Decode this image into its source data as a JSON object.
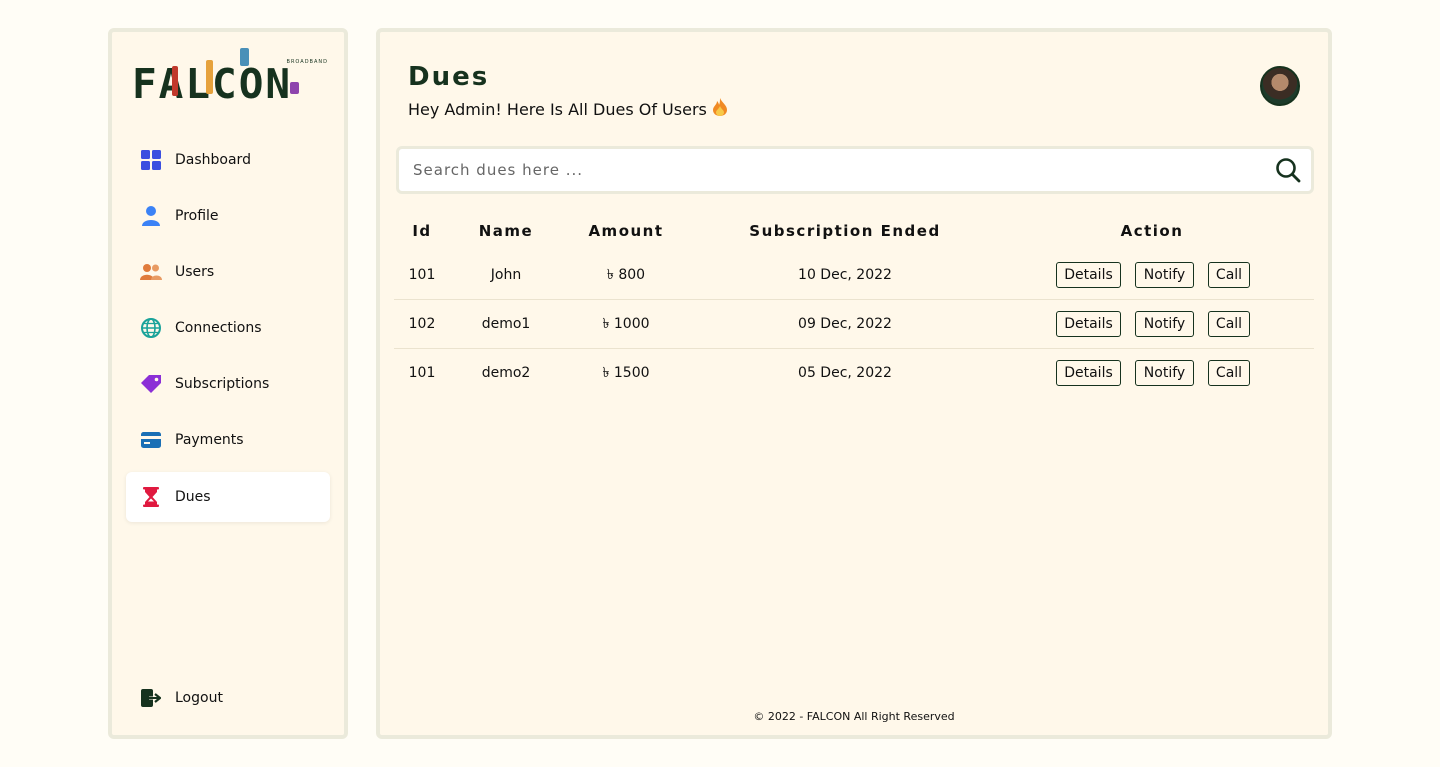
{
  "brand": {
    "name": "FALCON",
    "tagline": "BROADBAND"
  },
  "sidebar": {
    "items": [
      {
        "label": "Dashboard",
        "icon": "dashboard-grid-icon",
        "color": "#3b4fe0"
      },
      {
        "label": "Profile",
        "icon": "user-icon",
        "color": "#3b82f6"
      },
      {
        "label": "Users",
        "icon": "users-icon",
        "color": "#e07b3c"
      },
      {
        "label": "Connections",
        "icon": "globe-icon",
        "color": "#1aa39a"
      },
      {
        "label": "Subscriptions",
        "icon": "tags-icon",
        "color": "#8b2fd6"
      },
      {
        "label": "Payments",
        "icon": "credit-card-icon",
        "color": "#1a6fb5"
      },
      {
        "label": "Dues",
        "icon": "hourglass-icon",
        "color": "#e0193f",
        "active": true
      }
    ],
    "logout": {
      "label": "Logout",
      "icon": "logout-icon",
      "color": "#16321e"
    }
  },
  "header": {
    "title": "Dues",
    "subtitle": "Hey Admin! Here Is All Dues Of Users",
    "subtitle_icon": "flame-icon"
  },
  "search": {
    "placeholder": "Search dues here ...",
    "value": ""
  },
  "table": {
    "columns": [
      "Id",
      "Name",
      "Amount",
      "Subscription Ended",
      "Action"
    ],
    "rows": [
      {
        "id": "101",
        "name": "John",
        "amount": "৳ 800",
        "ended": "10 Dec, 2022"
      },
      {
        "id": "102",
        "name": "demo1",
        "amount": "৳ 1000",
        "ended": "09 Dec, 2022"
      },
      {
        "id": "101",
        "name": "demo2",
        "amount": "৳ 1500",
        "ended": "05 Dec, 2022"
      }
    ],
    "actions": {
      "details": "Details",
      "notify": "Notify",
      "call": "Call"
    }
  },
  "footer": "© 2022 - FALCON All Right Reserved",
  "colors": {
    "accent": "#16321e",
    "panel": "#fff8ea",
    "border": "#ebeadb",
    "background": "#fffdf6"
  }
}
